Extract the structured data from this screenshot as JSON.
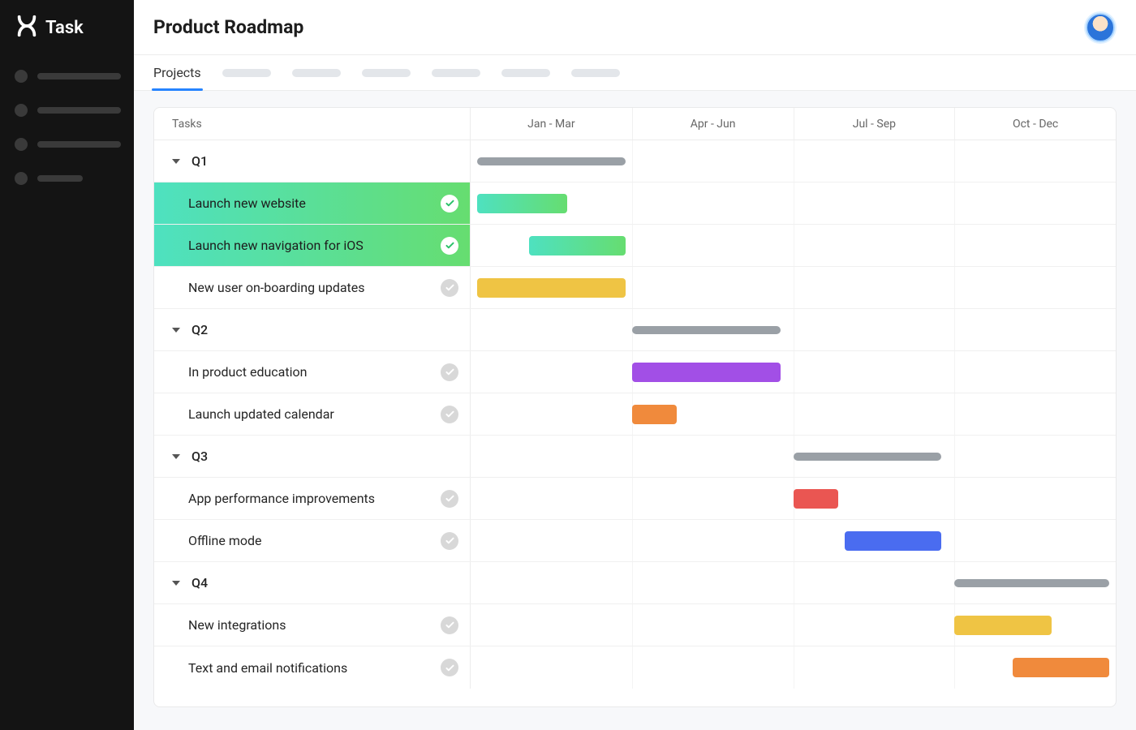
{
  "brand": {
    "name": "Task"
  },
  "header": {
    "title": "Product Roadmap"
  },
  "tabs": {
    "active_label": "Projects"
  },
  "timeline": {
    "columns_header": "Tasks",
    "periods": [
      "Jan - Mar",
      "Apr - Jun",
      "Jul - Sep",
      "Oct - Dec"
    ]
  },
  "chart_data": {
    "type": "gantt",
    "x_categories": [
      "Jan - Mar",
      "Apr - Jun",
      "Jul - Sep",
      "Oct - Dec"
    ],
    "x_unit": "quarter",
    "x_range_pct": [
      0,
      100
    ],
    "title": "Product Roadmap",
    "groups": [
      {
        "label": "Q1",
        "summary_bar": {
          "start_pct": 1,
          "end_pct": 24,
          "color": "grey"
        },
        "tasks": [
          {
            "label": "Launch new website",
            "done": true,
            "highlight": true,
            "bar": {
              "start_pct": 1,
              "end_pct": 15,
              "style": "grad-green"
            }
          },
          {
            "label": "Launch new navigation for iOS",
            "done": true,
            "highlight": true,
            "bar": {
              "start_pct": 9,
              "end_pct": 24,
              "style": "grad-green"
            }
          },
          {
            "label": "New user on-boarding updates",
            "done": false,
            "highlight": false,
            "bar": {
              "start_pct": 1,
              "end_pct": 24,
              "color": "yellow"
            }
          }
        ]
      },
      {
        "label": "Q2",
        "summary_bar": {
          "start_pct": 25,
          "end_pct": 48,
          "color": "grey"
        },
        "tasks": [
          {
            "label": "In product education",
            "done": false,
            "highlight": false,
            "bar": {
              "start_pct": 25,
              "end_pct": 48,
              "color": "purple"
            }
          },
          {
            "label": "Launch updated calendar",
            "done": false,
            "highlight": false,
            "bar": {
              "start_pct": 25,
              "end_pct": 32,
              "color": "orange"
            }
          }
        ]
      },
      {
        "label": "Q3",
        "summary_bar": {
          "start_pct": 50,
          "end_pct": 73,
          "color": "grey"
        },
        "tasks": [
          {
            "label": "App performance improvements",
            "done": false,
            "highlight": false,
            "bar": {
              "start_pct": 50,
              "end_pct": 57,
              "color": "red"
            }
          },
          {
            "label": "Offline mode",
            "done": false,
            "highlight": false,
            "bar": {
              "start_pct": 58,
              "end_pct": 73,
              "color": "blue"
            }
          }
        ]
      },
      {
        "label": "Q4",
        "summary_bar": {
          "start_pct": 75,
          "end_pct": 99,
          "color": "grey"
        },
        "tasks": [
          {
            "label": "New integrations",
            "done": false,
            "highlight": false,
            "bar": {
              "start_pct": 75,
              "end_pct": 90,
              "color": "yellow"
            }
          },
          {
            "label": "Text  and email notifications",
            "done": false,
            "highlight": false,
            "bar": {
              "start_pct": 84,
              "end_pct": 99,
              "color": "orange"
            }
          }
        ]
      }
    ]
  }
}
